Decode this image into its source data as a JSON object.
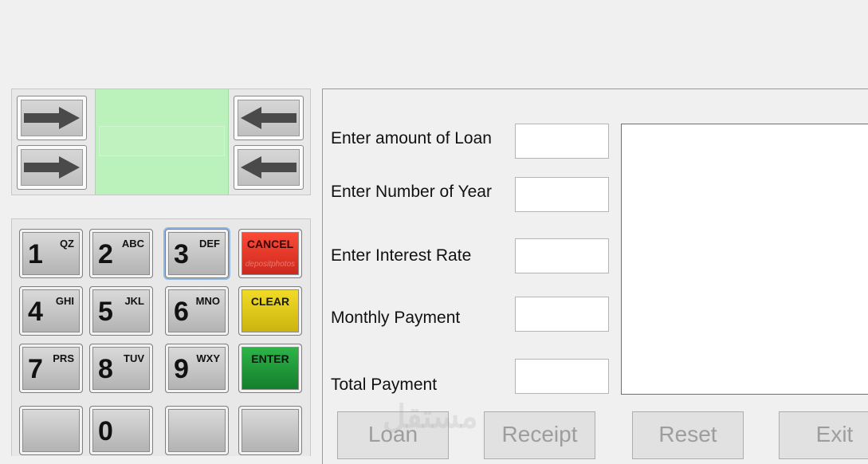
{
  "display": {
    "line": ""
  },
  "keypad": {
    "keys": [
      {
        "num": "1",
        "letters": "QZ"
      },
      {
        "num": "2",
        "letters": "ABC"
      },
      {
        "num": "3",
        "letters": "DEF"
      },
      {
        "num": "4",
        "letters": "GHI"
      },
      {
        "num": "5",
        "letters": "JKL"
      },
      {
        "num": "6",
        "letters": "MNO"
      },
      {
        "num": "7",
        "letters": "PRS"
      },
      {
        "num": "8",
        "letters": "TUV"
      },
      {
        "num": "9",
        "letters": "WXY"
      },
      {
        "num": "0",
        "letters": ""
      }
    ],
    "cancel": "CANCEL",
    "clear": "CLEAR",
    "enter": "ENTER",
    "cancel_watermark": "depositphotos"
  },
  "form": {
    "amount_label": "Enter amount of Loan",
    "years_label": "Enter Number of Year",
    "rate_label": "Enter Interest Rate",
    "monthly_label": "Monthly Payment",
    "total_label": "Total Payment",
    "amount_value": "",
    "years_value": "",
    "rate_value": "",
    "monthly_value": "",
    "total_value": ""
  },
  "buttons": {
    "loan": "Loan",
    "receipt": "Receipt",
    "reset": "Reset",
    "exit": "Exit"
  },
  "watermark": "مستقل"
}
